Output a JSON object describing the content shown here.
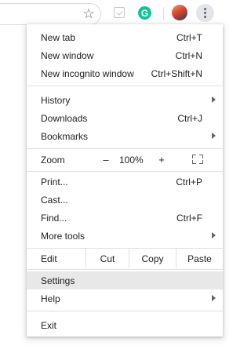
{
  "toolbar": {
    "icons": [
      "star-icon",
      "pocket-extension-icon",
      "grammarly-extension-icon",
      "profile-avatar",
      "more-vert-icon"
    ],
    "grammarly_letter": "G"
  },
  "menu": {
    "new_tab": {
      "label": "New tab",
      "shortcut": "Ctrl+T"
    },
    "new_window": {
      "label": "New window",
      "shortcut": "Ctrl+N"
    },
    "new_incognito": {
      "label": "New incognito window",
      "shortcut": "Ctrl+Shift+N"
    },
    "history": {
      "label": "History"
    },
    "downloads": {
      "label": "Downloads",
      "shortcut": "Ctrl+J"
    },
    "bookmarks": {
      "label": "Bookmarks"
    },
    "zoom": {
      "label": "Zoom",
      "minus": "–",
      "value": "100%",
      "plus": "+"
    },
    "print": {
      "label": "Print...",
      "shortcut": "Ctrl+P"
    },
    "cast": {
      "label": "Cast..."
    },
    "find": {
      "label": "Find...",
      "shortcut": "Ctrl+F"
    },
    "more_tools": {
      "label": "More tools"
    },
    "edit": {
      "label": "Edit",
      "cut": "Cut",
      "copy": "Copy",
      "paste": "Paste"
    },
    "settings": {
      "label": "Settings"
    },
    "help": {
      "label": "Help"
    },
    "exit": {
      "label": "Exit"
    }
  },
  "colors": {
    "highlight": "#e8e8e9",
    "grammarly": "#15c39a",
    "text": "#202124"
  }
}
